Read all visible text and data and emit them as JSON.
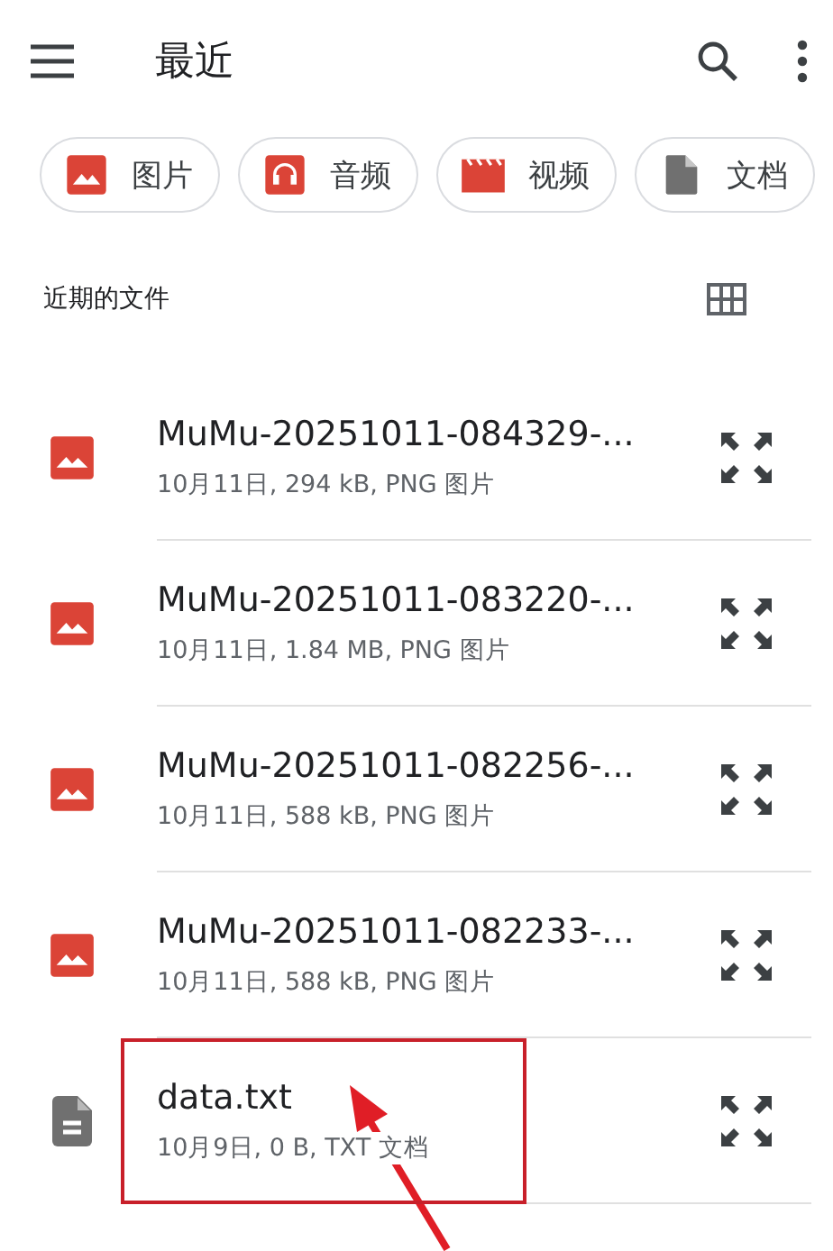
{
  "app_bar": {
    "title": "最近"
  },
  "chips": [
    {
      "kind": "image",
      "label": "图片"
    },
    {
      "kind": "audio",
      "label": "音频"
    },
    {
      "kind": "video",
      "label": "视频"
    },
    {
      "kind": "document",
      "label": "文档"
    }
  ],
  "section": {
    "label": "近期的文件"
  },
  "files": [
    {
      "kind": "image",
      "name": "MuMu-20251011-084329-...",
      "meta": "10月11日, 294 kB, PNG 图片",
      "highlighted": false
    },
    {
      "kind": "image",
      "name": "MuMu-20251011-083220-...",
      "meta": "10月11日, 1.84 MB, PNG 图片",
      "highlighted": false
    },
    {
      "kind": "image",
      "name": "MuMu-20251011-082256-...",
      "meta": "10月11日, 588 kB, PNG 图片",
      "highlighted": false
    },
    {
      "kind": "image",
      "name": "MuMu-20251011-082233-...",
      "meta": "10月11日, 588 kB, PNG 图片",
      "highlighted": false
    },
    {
      "kind": "document",
      "name": "data.txt",
      "meta": "10月9日, 0 B, TXT 文档",
      "highlighted": true
    }
  ]
}
